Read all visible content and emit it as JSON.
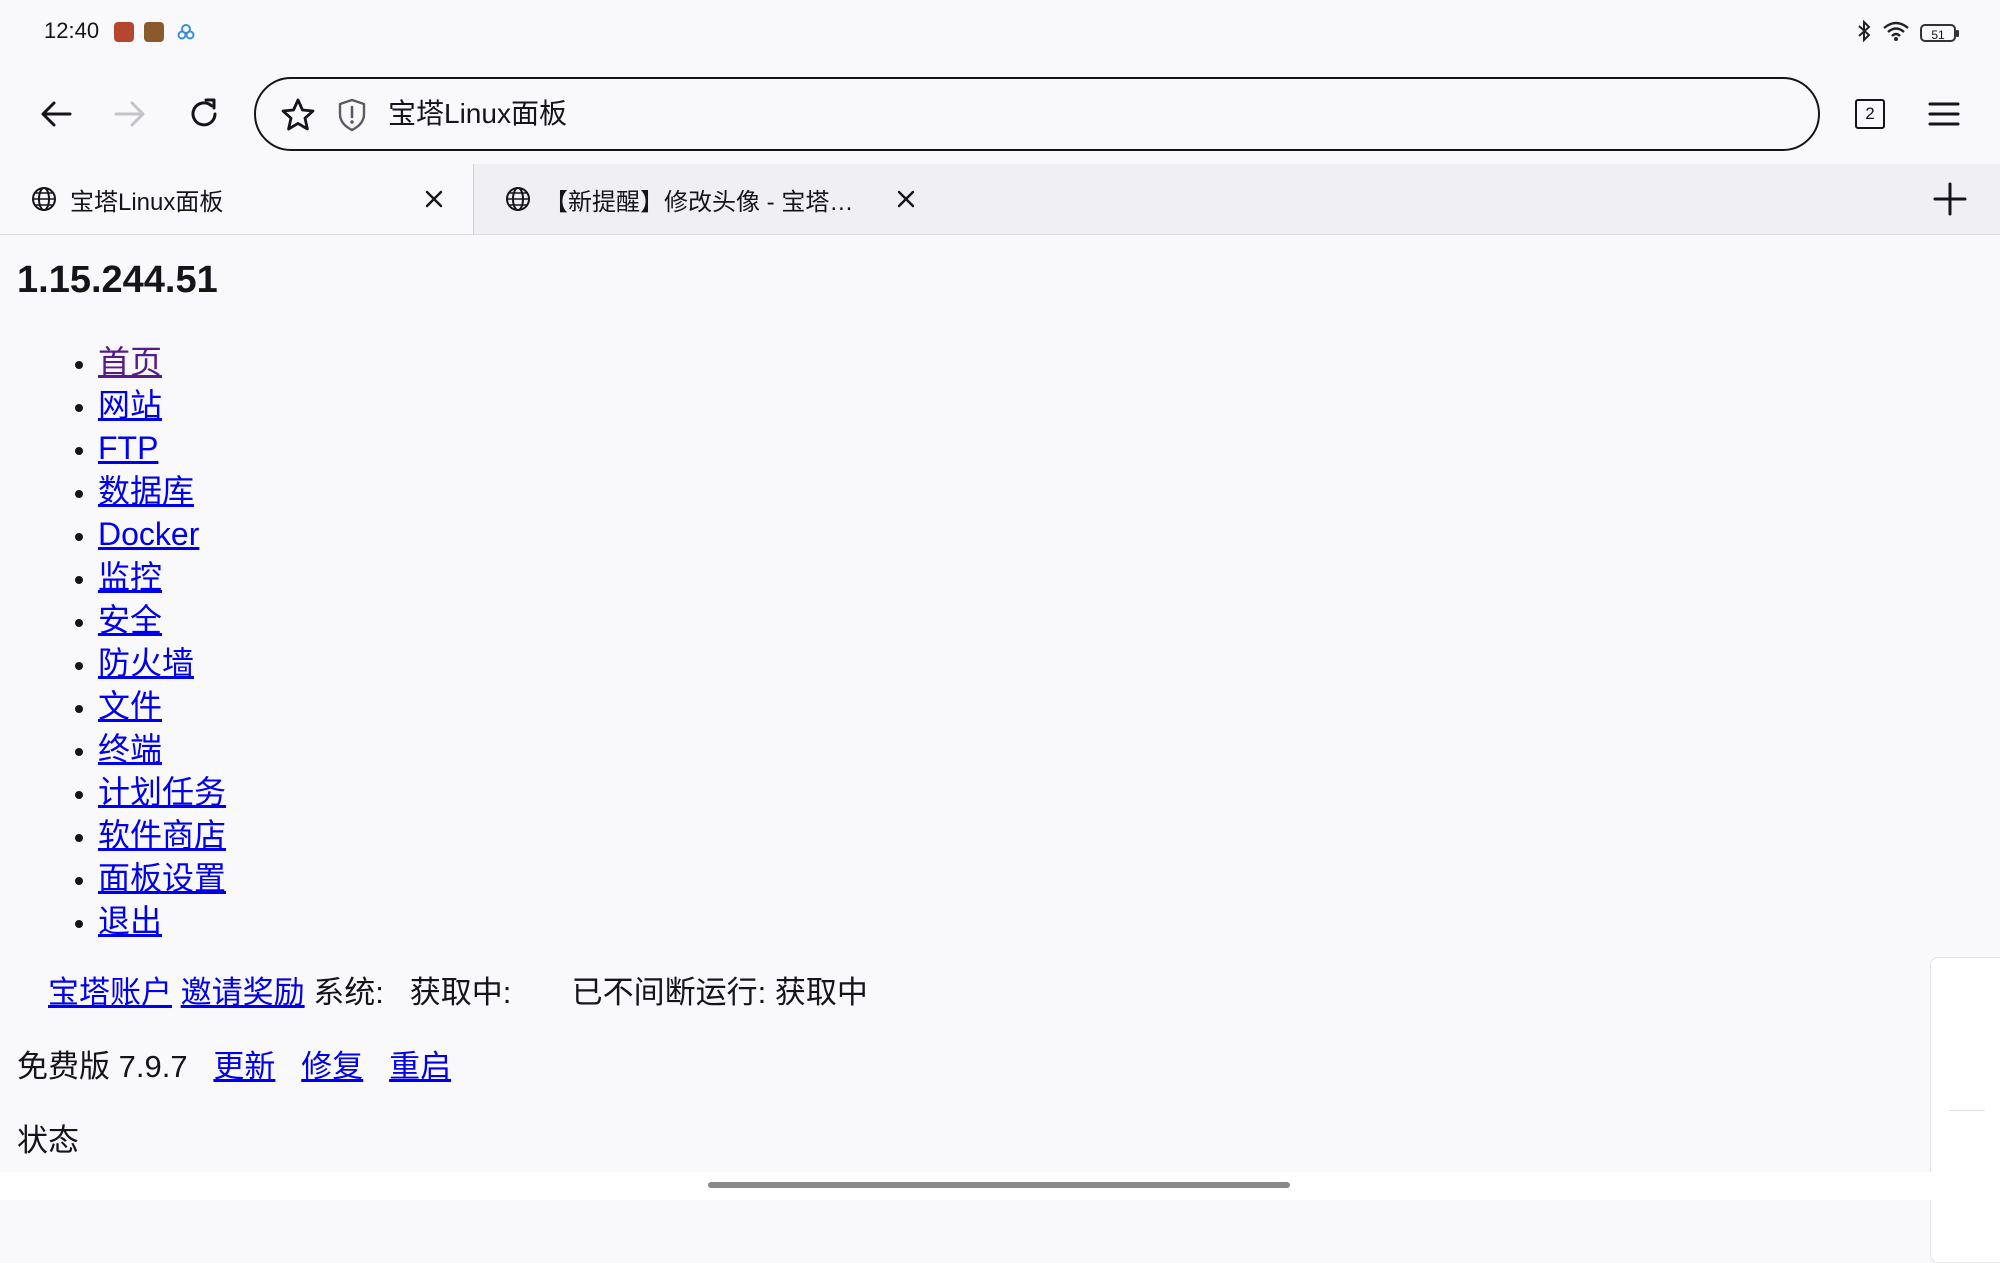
{
  "status_bar": {
    "time": "12:40",
    "battery": "51",
    "icons": [
      "notification-app-icon-1",
      "notification-app-icon-2",
      "notification-app-icon-3",
      "bluetooth-icon",
      "wifi-icon",
      "battery-icon"
    ]
  },
  "toolbar": {
    "url_text": "宝塔Linux面板",
    "tab_count": "2",
    "icons": [
      "back-arrow-icon",
      "forward-arrow-icon",
      "reload-icon",
      "bookmark-star-icon",
      "shield-icon",
      "tab-counter-icon",
      "menu-icon"
    ]
  },
  "tabs": [
    {
      "title": "宝塔Linux面板",
      "active": true
    },
    {
      "title": "【新提醒】修改头像 - 宝塔…",
      "active": false
    }
  ],
  "page": {
    "server_ip": "1.15.244.51",
    "nav_items": [
      {
        "label": "首页",
        "visited": true
      },
      {
        "label": "网站"
      },
      {
        "label": "FTP"
      },
      {
        "label": "数据库"
      },
      {
        "label": "Docker"
      },
      {
        "label": "监控"
      },
      {
        "label": "安全"
      },
      {
        "label": "防火墙"
      },
      {
        "label": "文件"
      },
      {
        "label": "终端"
      },
      {
        "label": "计划任务"
      },
      {
        "label": "软件商店"
      },
      {
        "label": "面板设置"
      },
      {
        "label": "退出"
      }
    ],
    "account_link": "宝塔账户",
    "invite_link": "邀请奖励",
    "system_text": "系统:   获取中:",
    "uptime_text": "已不间断运行: 获取中",
    "version_text": "免费版 7.9.7",
    "update_link": "更新",
    "repair_link": "修复",
    "restart_link": "重启",
    "status_text": "状态"
  },
  "colors": {
    "link": "#0000ee",
    "visited_link": "#551a8b",
    "background": "#f9f9fb",
    "tabstrip": "#f0f0f4"
  }
}
